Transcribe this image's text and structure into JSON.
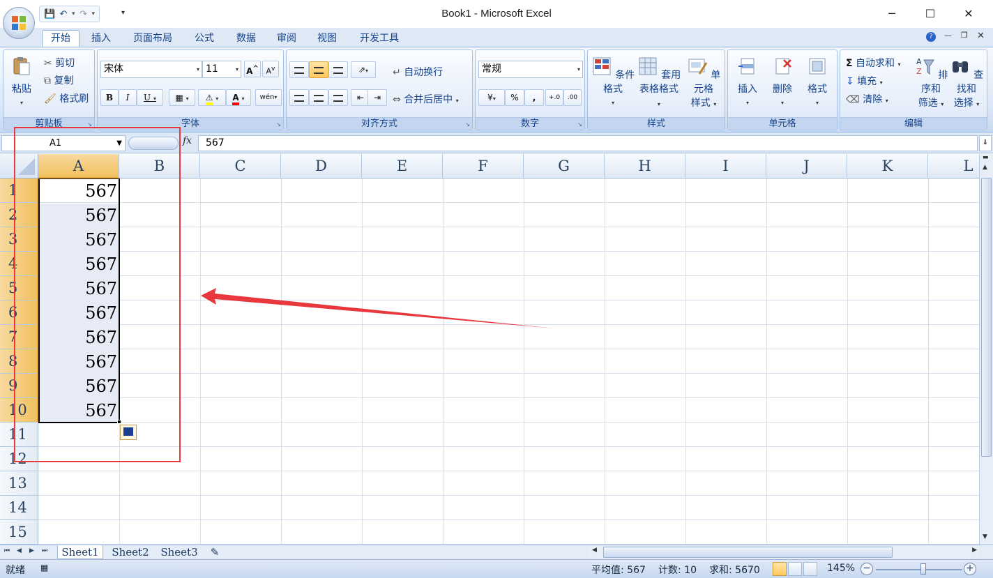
{
  "window": {
    "title": "Book1 - Microsoft Excel",
    "controls": [
      "─",
      "☐",
      "✕"
    ]
  },
  "qat": {
    "save_icon": "save-icon",
    "undo_icon": "undo-icon",
    "redo_icon": "redo-icon"
  },
  "ribbon_tabs": [
    "开始",
    "插入",
    "页面布局",
    "公式",
    "数据",
    "审阅",
    "视图",
    "开发工具"
  ],
  "active_tab": "开始",
  "ribbon": {
    "clipboard": {
      "label": "剪贴板",
      "paste": "粘贴",
      "cut": "剪切",
      "copy": "复制",
      "format_painter": "格式刷"
    },
    "font": {
      "label": "字体",
      "font_name": "宋体",
      "font_size": "11",
      "grow": "A",
      "shrink": "A",
      "bold": "B",
      "italic": "I",
      "underline": "U",
      "wen": "wén"
    },
    "alignment": {
      "label": "对齐方式",
      "wrap_text": "自动换行",
      "merge_center": "合并后居中"
    },
    "number": {
      "label": "数字",
      "format": "常规",
      "percent": "%",
      "comma": ",",
      "inc_decimal": "+.0",
      "dec_decimal": ".00"
    },
    "styles": {
      "label": "样式",
      "conditional": "条件格式",
      "table_1": "套用",
      "table_2": "表格格式",
      "cell_styles_1": "单元格",
      "cell_styles_2": "样式"
    },
    "cells": {
      "label": "单元格",
      "insert": "插入",
      "delete": "删除",
      "format": "格式"
    },
    "editing": {
      "label": "编辑",
      "autosum": "自动求和",
      "fill": "填充",
      "clear": "清除",
      "sort_1": "排序和",
      "sort_2": "筛选",
      "find_1": "查找和",
      "find_2": "选择"
    }
  },
  "formula_bar": {
    "name_box": "A1",
    "fx": "fx",
    "content": "567"
  },
  "columns": [
    "A",
    "B",
    "C",
    "D",
    "E",
    "F",
    "G",
    "H",
    "I",
    "J",
    "K",
    "L"
  ],
  "rows": [
    "1",
    "2",
    "3",
    "4",
    "5",
    "6",
    "7",
    "8",
    "9",
    "10",
    "11",
    "12",
    "13",
    "14",
    "15"
  ],
  "cells_A": [
    "567",
    "567",
    "567",
    "567",
    "567",
    "567",
    "567",
    "567",
    "567",
    "567"
  ],
  "sheet_tabs": [
    "Sheet1",
    "Sheet2",
    "Sheet3"
  ],
  "active_sheet": "Sheet1",
  "status": {
    "mode": "就绪",
    "average": "平均值: 567",
    "count": "计数: 10",
    "sum": "求和: 5670",
    "zoom": "145%"
  },
  "colors": {
    "annotation_red": "#e8383d",
    "selected_header": "#f1c15f",
    "ribbon_blue": "#dbe7f7"
  }
}
